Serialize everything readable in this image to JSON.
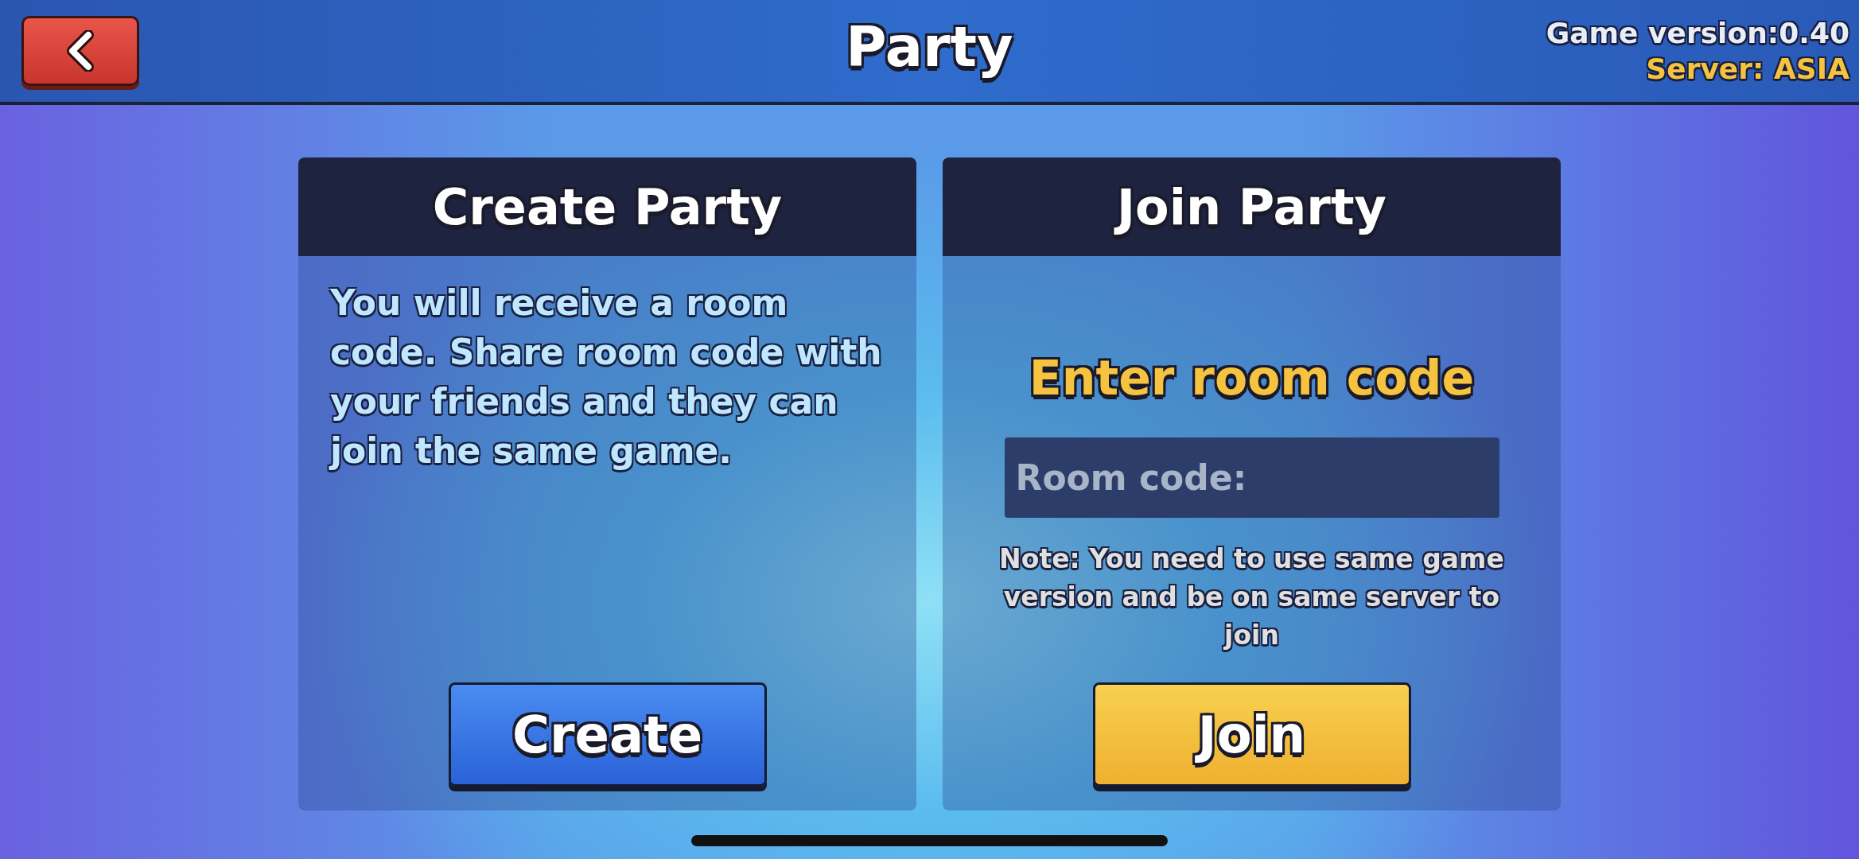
{
  "top_bar": {
    "title": "Party",
    "game_version": "Game version:0.40",
    "server": "Server: ASIA"
  },
  "create_panel": {
    "title": "Create Party",
    "description": "You will receive a room code. Share room code with your friends and they can join the same game.",
    "button": "Create"
  },
  "join_panel": {
    "title": "Join Party",
    "prompt": "Enter room code",
    "room_code_field": {
      "placeholder": "Room code:"
    },
    "note": "Note: You need to use same game version and be on same server to join",
    "button": "Join"
  }
}
